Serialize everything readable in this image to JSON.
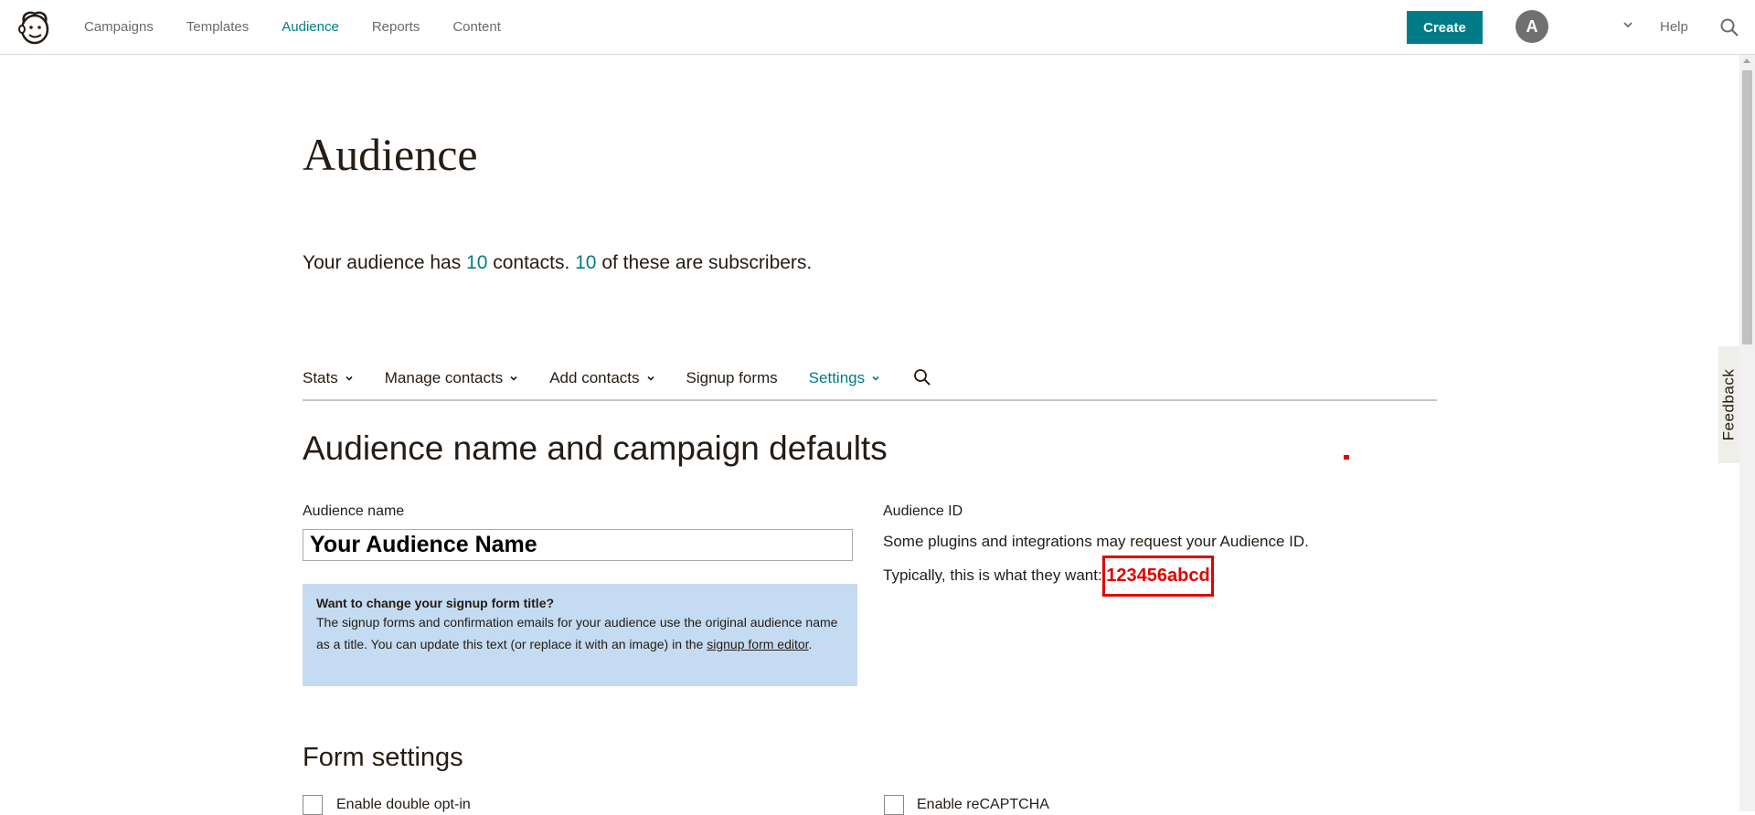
{
  "nav": {
    "links": [
      "Campaigns",
      "Templates",
      "Audience",
      "Reports",
      "Content"
    ],
    "active": "Audience",
    "create_label": "Create",
    "avatar_letter": "A",
    "help_label": "Help"
  },
  "feedback_label": "Feedback",
  "page": {
    "title": "Audience",
    "summary": {
      "prefix": "Your audience has ",
      "contacts": "10",
      "mid": " contacts. ",
      "subscribers": "10",
      "suffix": " of these are subscribers."
    }
  },
  "subnav": {
    "items": [
      "Stats",
      "Manage contacts",
      "Add contacts",
      "Signup forms",
      "Settings"
    ],
    "active": "Settings"
  },
  "section": {
    "title": "Audience name and campaign defaults",
    "audience_name_label": "Audience name",
    "audience_name_value": "Your Audience Name",
    "info_box": {
      "title": "Want to change your signup form title?",
      "body": "The signup forms and confirmation emails for your audience use the original audience name as a title. You can update this text (or replace it with an image) in the ",
      "link": "signup form editor",
      "end": "."
    },
    "audience_id_label": "Audience ID",
    "audience_id_desc": "Some plugins and integrations may request your Audience ID.",
    "audience_id_line": "Typically, this is what they want:",
    "audience_id_value": "123456abcd"
  },
  "form_settings": {
    "title": "Form settings",
    "double_optin_label": "Enable double opt-in",
    "recaptcha_label": "Enable reCAPTCHA"
  },
  "colors": {
    "accent": "#007c89",
    "highlight": "#e20000",
    "info_bg": "#c4dbf1"
  }
}
